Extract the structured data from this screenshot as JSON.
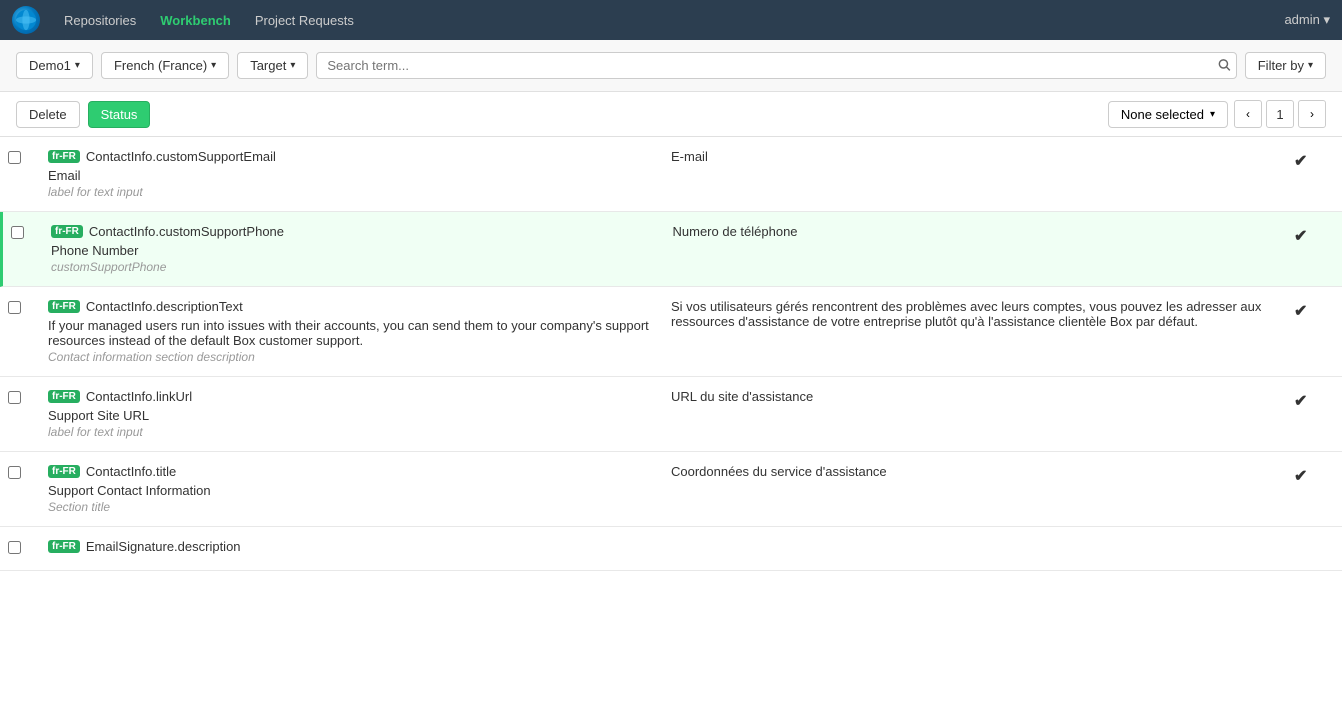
{
  "nav": {
    "repositories_label": "Repositories",
    "workbench_label": "Workbench",
    "project_requests_label": "Project Requests",
    "user_label": "admin ▾"
  },
  "toolbar": {
    "demo_label": "Demo1",
    "language_label": "French (France)",
    "target_label": "Target",
    "search_placeholder": "Search term...",
    "filter_label": "Filter by"
  },
  "action_bar": {
    "delete_label": "Delete",
    "status_label": "Status",
    "none_selected_label": "None selected",
    "page_number": "1"
  },
  "rows": [
    {
      "id": "row1",
      "key": "ContactInfo.customSupportEmail",
      "lang": "fr-FR",
      "source_main": "Email",
      "source_sub": "label for text input",
      "translation": "E-mail",
      "checked": false,
      "approved": true,
      "selected": false
    },
    {
      "id": "row2",
      "key": "ContactInfo.customSupportPhone",
      "lang": "fr-FR",
      "source_main": "Phone Number",
      "source_sub": "customSupportPhone",
      "translation": "Numero de téléphone",
      "checked": false,
      "approved": true,
      "selected": true
    },
    {
      "id": "row3",
      "key": "ContactInfo.descriptionText",
      "lang": "fr-FR",
      "source_main": "If your managed users run into issues with their accounts, you can send them to your company's support resources instead of the default Box customer support.",
      "source_sub": "Contact information section description",
      "translation": "Si vos utilisateurs gérés rencontrent des problèmes avec leurs comptes, vous pouvez les adresser aux ressources d'assistance de votre entreprise plutôt qu'à l'assistance clientèle Box par défaut.",
      "checked": false,
      "approved": true,
      "selected": false
    },
    {
      "id": "row4",
      "key": "ContactInfo.linkUrl",
      "lang": "fr-FR",
      "source_main": "Support Site URL",
      "source_sub": "label for text input",
      "translation": "URL du site d'assistance",
      "checked": false,
      "approved": true,
      "selected": false
    },
    {
      "id": "row5",
      "key": "ContactInfo.title",
      "lang": "fr-FR",
      "source_main": "Support Contact Information",
      "source_sub": "Section title",
      "translation": "Coordonnées du service d'assistance",
      "checked": false,
      "approved": true,
      "selected": false
    },
    {
      "id": "row6",
      "key": "EmailSignature.description",
      "lang": "fr-FR",
      "source_main": "",
      "source_sub": "",
      "translation": "",
      "checked": false,
      "approved": false,
      "selected": false
    }
  ]
}
